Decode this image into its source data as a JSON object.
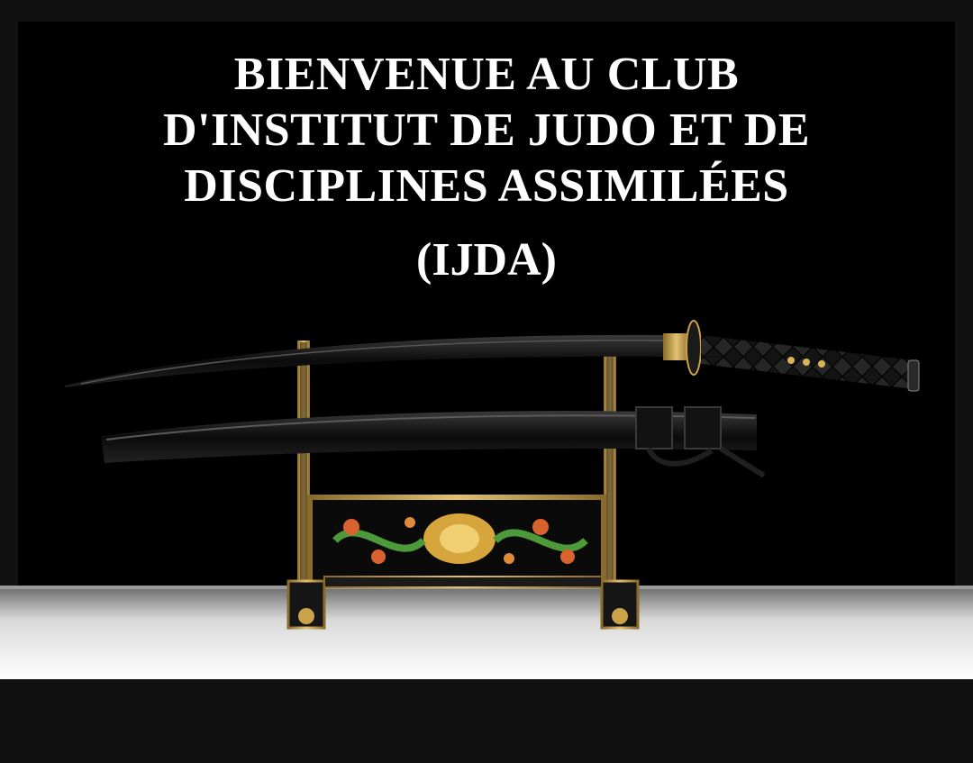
{
  "heading": {
    "line1": "BIENVENUE AU CLUB",
    "line2": "D'INSTITUT DE JUDO ET DE",
    "line3": "DISCIPLINES ASSIMILÉES",
    "acronym": "(IJDA)"
  },
  "colors": {
    "text": "#ffffff",
    "background": "#000000",
    "frame": "#111111",
    "floor": "#ffffff",
    "gold": "#c9a24a"
  }
}
